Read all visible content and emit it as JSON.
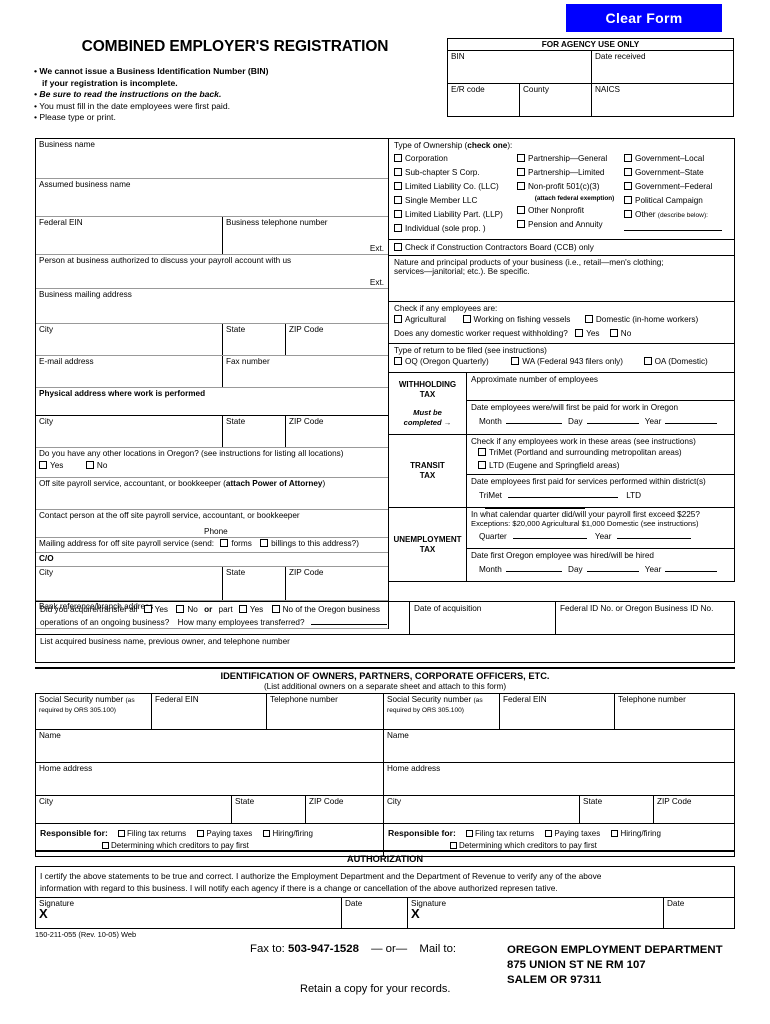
{
  "clear_form_button": "Clear Form",
  "title": "COMBINED EMPLOYER'S REGISTRATION",
  "bullets": [
    "We cannot issue a Business Identification Number (BIN)",
    "if your registration is incomplete.",
    "Be sure to read the instructions on the back.",
    "You must fill in the date employees were first paid.",
    "Please type or print."
  ],
  "agency": {
    "header": "FOR AGENCY USE ONLY",
    "bin": "BIN",
    "date_received": "Date received",
    "er_code": "E/R code",
    "county": "County",
    "naics": "NAICS"
  },
  "left": {
    "business_name": "Business name",
    "assumed_business_name": "Assumed business name",
    "federal_ein": "Federal EIN",
    "business_telephone": "Business telephone number",
    "ext": "Ext.",
    "authorized_person": "Person at business authorized to discuss your payroll account with us",
    "business_mailing_address": "Business mailing address",
    "city": "City",
    "state": "State",
    "zip": "ZIP Code",
    "email": "E-mail address",
    "fax": "Fax number",
    "physical_address": "Physical address where work is performed",
    "other_locations_q": "Do you have any other locations in Oregon? (see instructions for listing all locations)",
    "yes": "Yes",
    "no": "No",
    "offsite_service": "Off site payroll service, accountant, or bookkeeper (",
    "offsite_service_bold": "attach Power of Attorney",
    "offsite_service_end": ")",
    "offsite_contact": "Contact person at the off site payroll service, accountant, or bookkeeper",
    "phone": "Phone",
    "mailing_offsite_pre": "Mailing address for off site payroll service (send:",
    "forms": "forms",
    "billings": "billings to this address?)",
    "co": "C/O",
    "bank_reference": "Bank reference/branch address"
  },
  "ownership": {
    "heading_pre": "Type of Ownership (",
    "heading_bold": "check one",
    "heading_post": "):",
    "col1": [
      "Corporation",
      "Sub-chapter S Corp.",
      "Limited Liability Co. (LLC)",
      "Single Member LLC",
      "Limited Liability Part. (LLP)",
      "Individual (sole prop. )"
    ],
    "col2": [
      "Partnership—General",
      "Partnership—Limited",
      "Non-profit 501(c)(3)",
      "Other Nonprofit",
      "Pension and Annuity"
    ],
    "col2_note": "(attach federal exemption)",
    "col3": [
      "Government–Local",
      "Government–State",
      "Government–Federal",
      "Political Campaign"
    ],
    "col3_other": "Other",
    "col3_other_note": "(describe below):",
    "ccb": "Check if Construction Contractors Board (CCB) only"
  },
  "right": {
    "nature_line1": "Nature and principal products of your business (i.e., retail—men's clothing;",
    "nature_line2": "services—janitorial; etc.). Be specific.",
    "check_employees": "Check if any employees are:",
    "agricultural": "Agricultural",
    "fishing": "Working on fishing vessels",
    "domestic": "Domestic (in-home workers)",
    "domestic_withholding_q": "Does any domestic worker request withholding?",
    "yes": "Yes",
    "no": "No",
    "return_type": "Type of return to be filed (see instructions)",
    "oq": "OQ (Oregon Quarterly)",
    "wa": "WA (Federal 943 filers only)",
    "oa": "OA (Domestic)",
    "withholding_label1": "WITHHOLDING",
    "withholding_label2": "TAX",
    "must_be": "Must be",
    "completed": "completed",
    "approx_employees": "Approximate number of employees",
    "date_first_paid": "Date employees were/will first be paid for work in Oregon",
    "month": "Month",
    "day": "Day",
    "year": "Year",
    "transit_label1": "TRANSIT",
    "transit_label2": "TAX",
    "transit_q": "Check if any employees work in these areas (see instructions)",
    "trimet": "TriMet (Portland and surrounding metropolitan areas)",
    "ltd": "LTD (Eugene and Springfield areas)",
    "transit_date": "Date employees first paid for services performed within district(s)",
    "trimet_short": "TriMet",
    "ltd_short": "LTD",
    "unemployment_label1": "UNEMPLOYMENT",
    "unemployment_label2": "TAX",
    "quarter_q": "In what calendar quarter did/will your payroll first exceed $225?",
    "exceptions": "Exceptions: $20,000 Agricultural      $1,000 Domestic (see instructions)",
    "quarter": "Quarter",
    "hired_date": "Date first Oregon employee was hired/will be hired"
  },
  "acquire": {
    "line1_a": "Did you acquire/transfer all",
    "yes": "Yes",
    "no": "No",
    "or": "or",
    "part": "part",
    "line1_b": "of the Oregon business",
    "line2_a": "operations of an ongoing business?",
    "line2_b": "How many employees transferred?",
    "list_acquired": "List acquired business name, previous owner, and telephone number",
    "date_of_acquisition": "Date of acquisition",
    "federal_id": "Federal ID No. or Oregon Business ID No."
  },
  "owners": {
    "heading": "IDENTIFICATION OF OWNERS, PARTNERS, CORPORATE OFFICERS, ETC.",
    "subheading": "(List additional owners on a separate sheet and attach to this form)",
    "ssn": "Social Security number",
    "ssn_note": "(as required by ORS 305.100)",
    "federal_ein": "Federal EIN",
    "telephone": "Telephone number",
    "name": "Name",
    "home_address": "Home address",
    "city": "City",
    "state": "State",
    "zip": "ZIP Code",
    "responsible_for": "Responsible for:",
    "filing": "Filing tax returns",
    "paying": "Paying taxes",
    "hiring": "Hiring/firing",
    "creditors": "Determining which creditors to pay first"
  },
  "authorization": {
    "heading": "AUTHORIZATION",
    "line1": "I certify the above statements to be true and correct. I authorize the Employment Department and the Department of Revenue to verify any of the above",
    "line2": "information with regard to this business. I will notify each agency if there is a change or cancellation of the above authorized represen tative.",
    "signature": "Signature",
    "date": "Date",
    "x": "X"
  },
  "footer": {
    "form_number": "150-211-055 (Rev. 10-05) Web",
    "fax_to": "Fax to:",
    "fax_number": "503-947-1528",
    "or": "— or—",
    "mail_to": "Mail to:",
    "agency_name": "OREGON EMPLOYMENT DEPARTMENT",
    "address": "875 UNION ST NE RM 107",
    "city_state_zip": "SALEM OR 97311",
    "retain": "Retain a copy for your records."
  }
}
